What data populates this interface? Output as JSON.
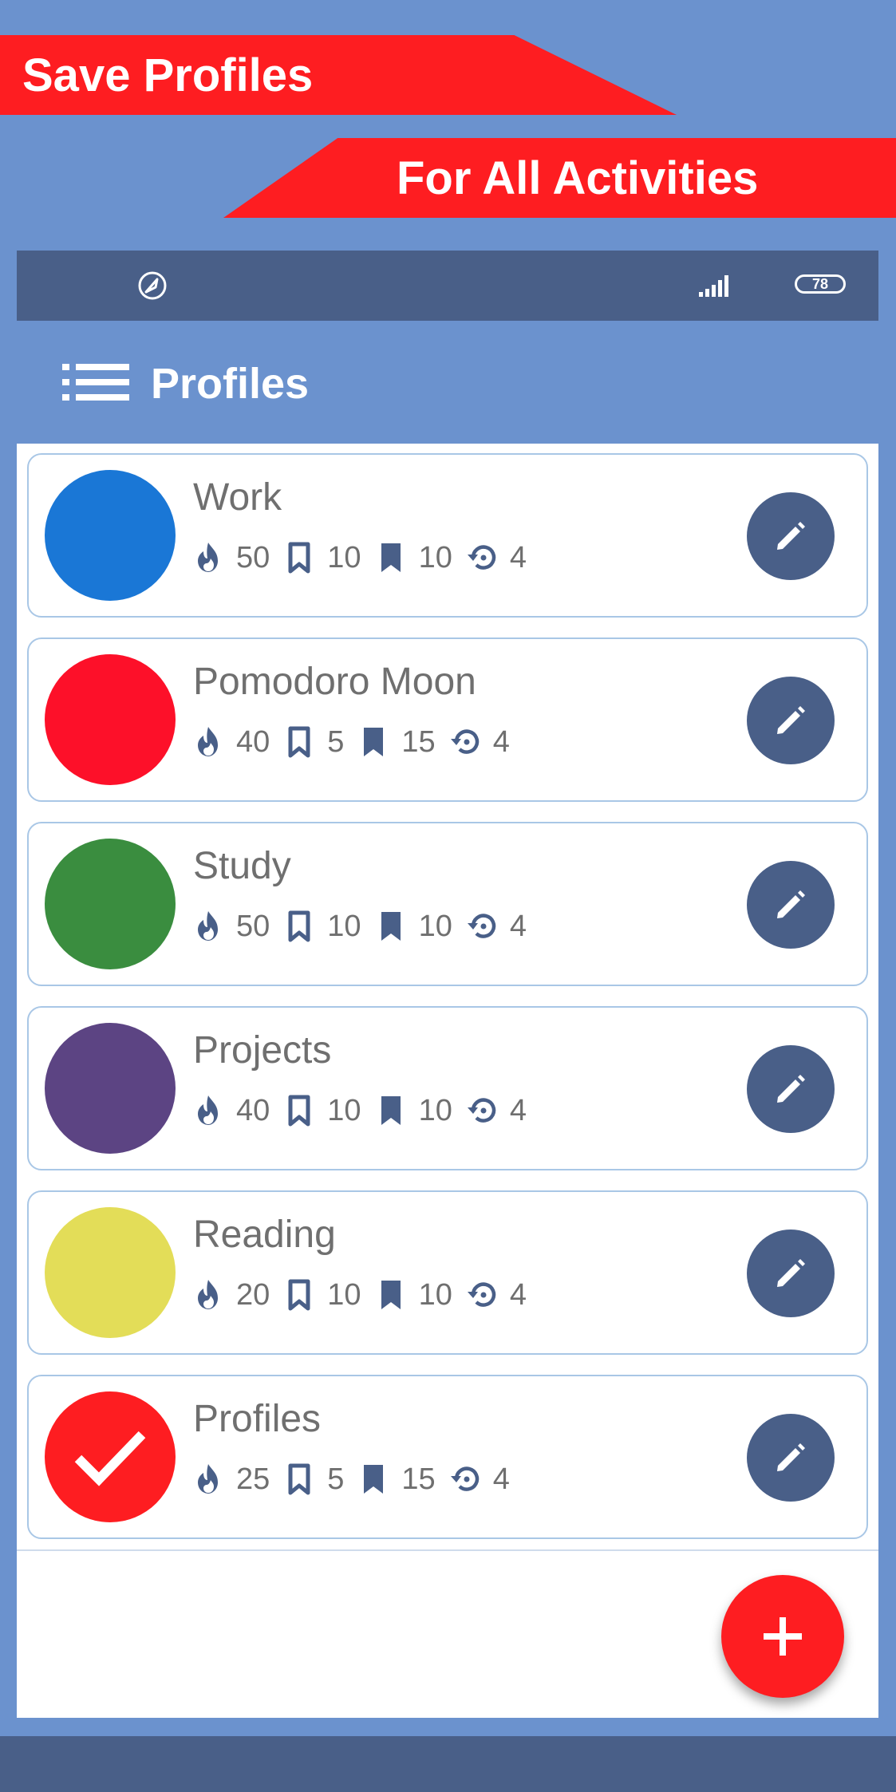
{
  "promo": {
    "banner_top": "Save Profiles",
    "banner_bottom": "For All Activities"
  },
  "status_bar": {
    "battery": "78",
    "app_icon": "rocket-icon",
    "signal_icon": "signal-icon"
  },
  "app_bar": {
    "title": "Profiles",
    "menu_icon": "list-menu-icon"
  },
  "profiles": [
    {
      "name": "Work",
      "color": "#1a77d6",
      "selected": false,
      "focus": "50",
      "short_break": "10",
      "long_break": "10",
      "rounds": "4"
    },
    {
      "name": "Pomodoro Moon",
      "color": "#fd1029",
      "selected": false,
      "focus": "40",
      "short_break": "5",
      "long_break": "15",
      "rounds": "4"
    },
    {
      "name": "Study",
      "color": "#3a8d3f",
      "selected": false,
      "focus": "50",
      "short_break": "10",
      "long_break": "10",
      "rounds": "4"
    },
    {
      "name": "Projects",
      "color": "#5c4483",
      "selected": false,
      "focus": "40",
      "short_break": "10",
      "long_break": "10",
      "rounds": "4"
    },
    {
      "name": "Reading",
      "color": "#e3dd58",
      "selected": false,
      "focus": "20",
      "short_break": "10",
      "long_break": "10",
      "rounds": "4"
    },
    {
      "name": "Profiles",
      "color": "#fe1d21",
      "selected": true,
      "focus": "25",
      "short_break": "5",
      "long_break": "15",
      "rounds": "4"
    }
  ],
  "stat_icons": [
    "flame-icon",
    "bookmark-outline-icon",
    "bookmark-filled-icon",
    "repeat-icon"
  ],
  "colors": {
    "background": "#6b92ce",
    "primary_dark": "#495f88",
    "accent": "#fe1d21",
    "card_border": "#a9c7e6",
    "text": "#6f6f6f"
  },
  "fab": {
    "icon": "plus-icon"
  }
}
